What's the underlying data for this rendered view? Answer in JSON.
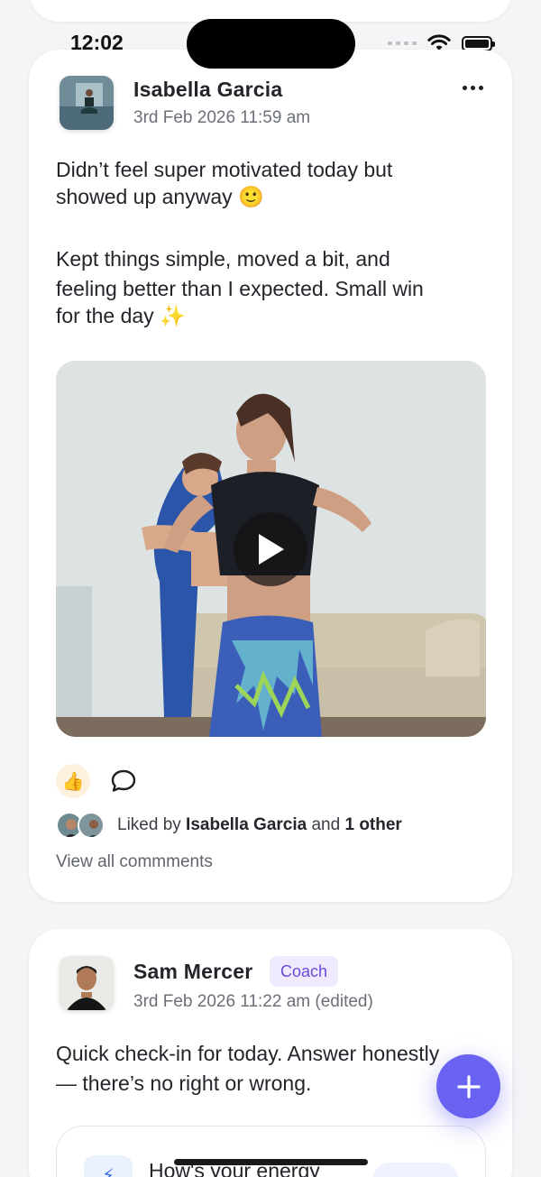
{
  "status_bar": {
    "time": "12:02"
  },
  "post1": {
    "author": "Isabella Garcia",
    "timestamp": "3rd Feb 2026 11:59 am",
    "text_p1_line1": "Didn’t feel super motivated today but",
    "text_p1_line2": "showed up anyway 🙂",
    "text_p2_line1": "Kept things simple, moved a bit, and",
    "text_p2_line2": "feeling better than I expected. Small win",
    "text_p2_line3": "for the day ✨",
    "reaction_emoji": "👍",
    "liked_prefix": "Liked by ",
    "liked_name": "Isabella Garcia",
    "liked_and": " and ",
    "liked_other": "1 other",
    "view_comments": "View all commments"
  },
  "post2": {
    "author": "Sam Mercer",
    "role_badge": "Coach",
    "timestamp": "3rd Feb 2026 11:22 am (edited)",
    "text_line1": "Quick check-in for today. Answer honestly",
    "text_line2": "— there’s no right or wrong.",
    "question_partial": "How's your energy"
  },
  "colors": {
    "accent": "#6a63f2",
    "coach_badge_bg": "#efeafd",
    "coach_badge_text": "#6a4bd8",
    "background": "#f4f5f7"
  },
  "icons": [
    "more-horizontal-icon",
    "thumbs-up-icon",
    "comment-bubble-icon",
    "play-icon",
    "plus-icon",
    "wifi-icon",
    "battery-icon",
    "signal-icon"
  ]
}
